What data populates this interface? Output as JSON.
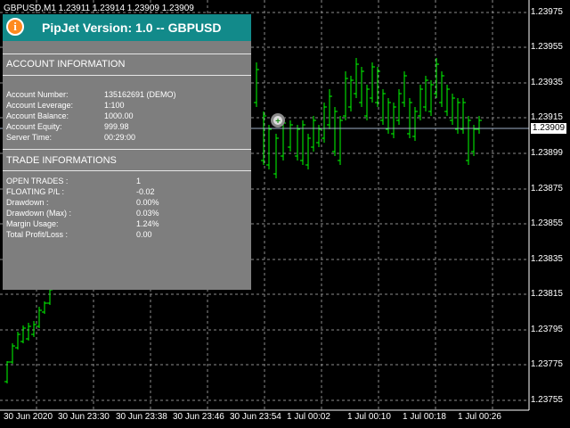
{
  "chart": {
    "symbol_title": "GBPUSD,M1  1.23911 1.23914 1.23909 1.23909",
    "current_price": "1.23909",
    "price_axis": [
      "1.23975",
      "1.23955",
      "1.23935",
      "1.23915",
      "1.23899",
      "1.23875",
      "1.23855",
      "1.23835",
      "1.23815",
      "1.23795",
      "1.23775",
      "1.23755"
    ],
    "time_axis": [
      "30 Jun 2020",
      "30 Jun 23:30",
      "30 Jun 23:38",
      "30 Jun 23:46",
      "30 Jun 23:54",
      "1 Jul 00:02",
      "1 Jul 00:10",
      "1 Jul 00:18",
      "1 Jul 00:26"
    ],
    "colors": {
      "background": "#000000",
      "grid": "#8c8c8c",
      "bar": "#00ff00",
      "panel": "#7e7e7e",
      "header": "#128a8a",
      "logo": "#ff8a1f"
    }
  },
  "panel": {
    "title": "PipJet Version: 1.0  --  GBPUSD",
    "logo_letter": "i",
    "account_section": "ACCOUNT INFORMATION",
    "account_rows": [
      {
        "label": "Account Number:",
        "value": "135162691 (DEMO)"
      },
      {
        "label": "Account Leverage:",
        "value": "1:100"
      },
      {
        "label": "Account Balance:",
        "value": "1000.00"
      },
      {
        "label": "Account Equity:",
        "value": "999.98"
      },
      {
        "label": "Server Time:",
        "value": "00:29:00"
      }
    ],
    "trade_section": "TRADE INFORMATIONS",
    "trade_rows": [
      {
        "label": "OPEN TRADES :",
        "value": "1"
      },
      {
        "label": "FLOATING P/L :",
        "value": "-0.02"
      },
      {
        "label": "Drawdown :",
        "value": "0.00%"
      },
      {
        "label": "Drawdown (Max) :",
        "value": "0.03%"
      },
      {
        "label": "Margin Usage:",
        "value": "1.24%"
      },
      {
        "label": "Total Profit/Loss :",
        "value": "0.00"
      }
    ]
  }
}
